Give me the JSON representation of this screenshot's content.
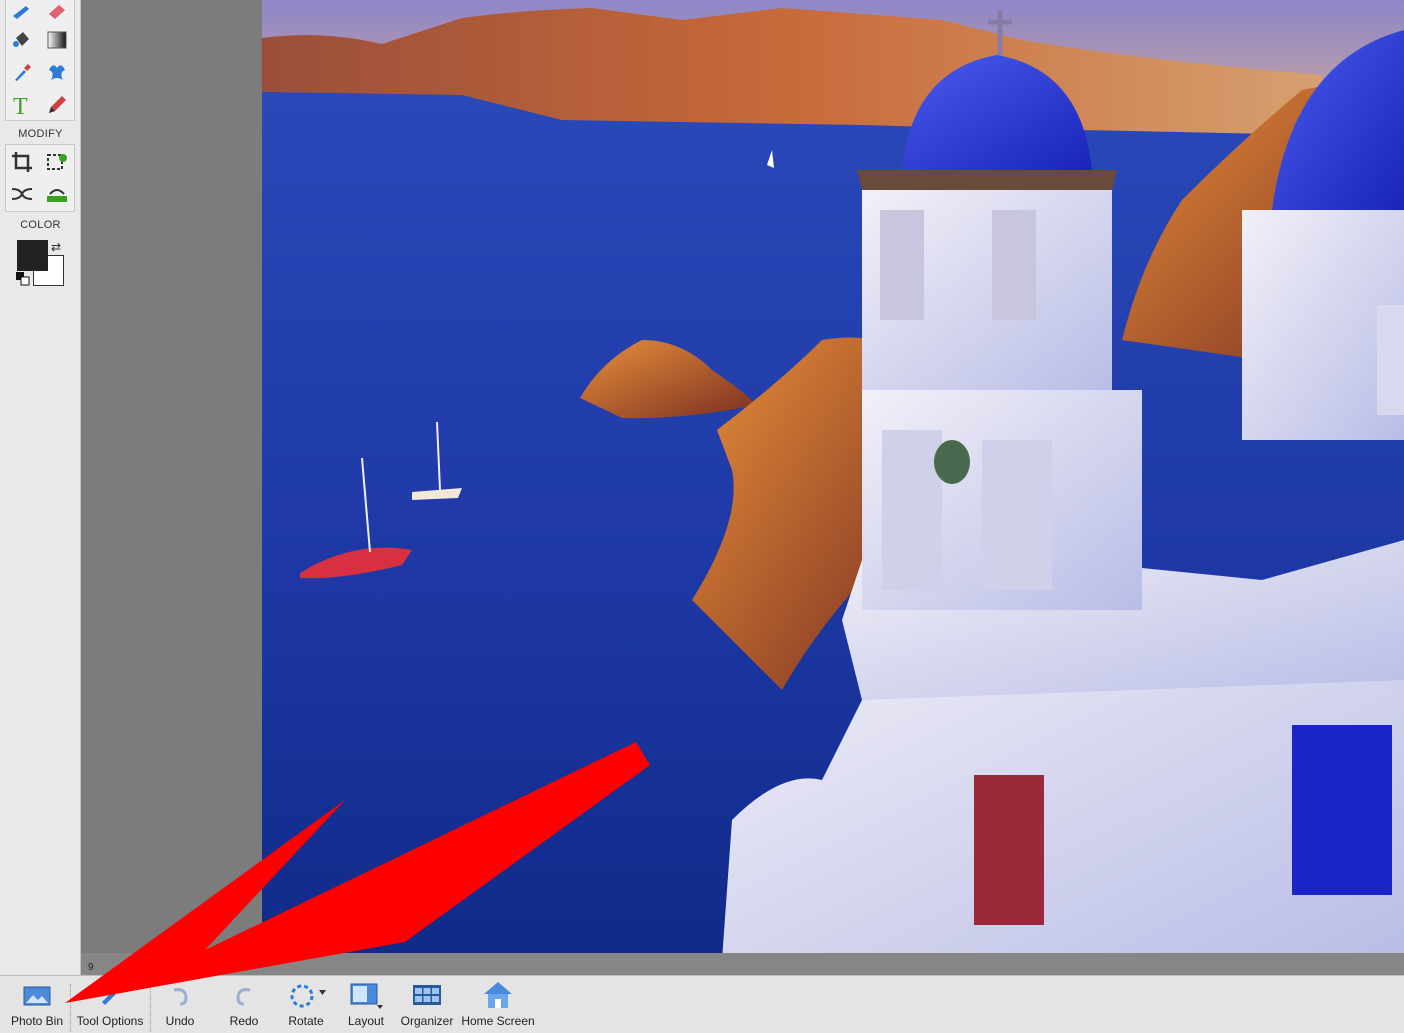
{
  "toolbox": {
    "modify_label": "MODIFY",
    "color_label": "COLOR",
    "tools": [
      {
        "name": "brush-tool",
        "icon": "brush-icon"
      },
      {
        "name": "eraser-tool",
        "icon": "eraser-icon"
      },
      {
        "name": "paint-bucket-tool",
        "icon": "paint-bucket-icon"
      },
      {
        "name": "gradient-tool",
        "icon": "gradient-icon"
      },
      {
        "name": "eyedropper-tool",
        "icon": "eyedropper-icon"
      },
      {
        "name": "custom-shape-tool",
        "icon": "puzzle-shape-icon"
      },
      {
        "name": "type-tool",
        "icon": "type-icon"
      },
      {
        "name": "pencil-tool",
        "icon": "pencil-icon"
      },
      {
        "name": "crop-tool",
        "icon": "crop-icon"
      },
      {
        "name": "recompose-tool",
        "icon": "recompose-icon"
      },
      {
        "name": "content-aware-move-tool",
        "icon": "shuffle-icon"
      },
      {
        "name": "straighten-tool",
        "icon": "straighten-icon"
      }
    ],
    "foreground_color": "#222222",
    "background_color": "#ffffff"
  },
  "status": {
    "zoom_partial": "9"
  },
  "bottombar": {
    "buttons": [
      {
        "label": "Photo Bin",
        "icon": "photo-bin-icon"
      },
      {
        "label": "Tool Options",
        "icon": "tool-options-icon"
      },
      {
        "label": "Undo",
        "icon": "undo-icon"
      },
      {
        "label": "Redo",
        "icon": "redo-icon"
      },
      {
        "label": "Rotate",
        "icon": "rotate-icon"
      },
      {
        "label": "Layout",
        "icon": "layout-icon"
      },
      {
        "label": "Organizer",
        "icon": "organizer-icon"
      },
      {
        "label": "Home Screen",
        "icon": "home-icon"
      }
    ]
  },
  "annotation": {
    "arrow_color": "#ff0000"
  }
}
